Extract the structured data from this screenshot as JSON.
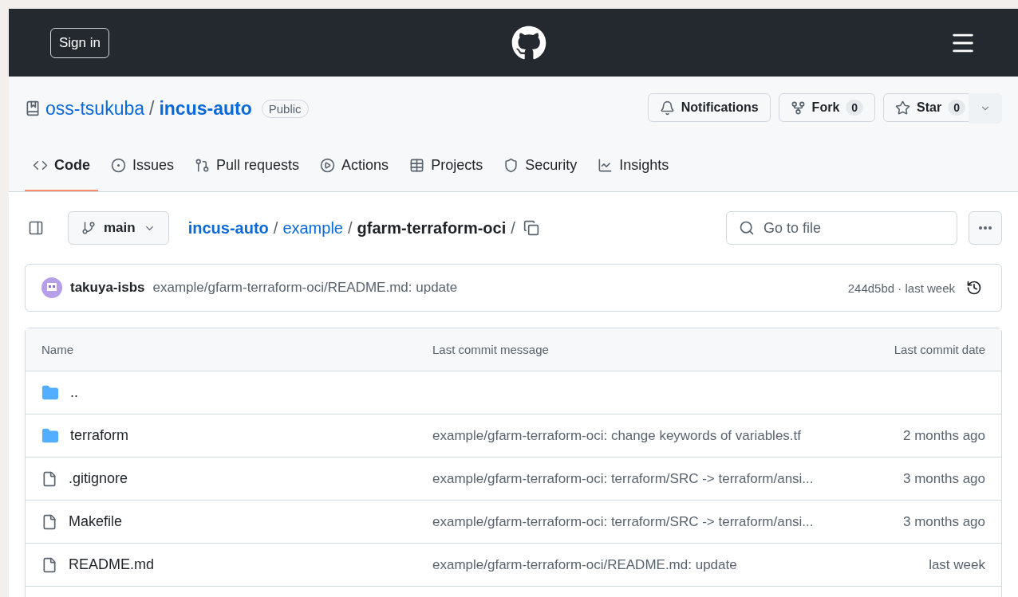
{
  "header": {
    "sign_in": "Sign in"
  },
  "repo": {
    "owner": "oss-tsukuba",
    "separator": "/",
    "name": "incus-auto",
    "visibility": "Public",
    "actions": [
      {
        "kind": "notifications",
        "label": "Notifications"
      },
      {
        "kind": "fork",
        "label": "Fork",
        "count": "0"
      },
      {
        "kind": "star",
        "label": "Star",
        "count": "0"
      }
    ]
  },
  "tabs": [
    {
      "kind": "code",
      "label": "Code",
      "selected": true
    },
    {
      "kind": "issues",
      "label": "Issues",
      "selected": false
    },
    {
      "kind": "pulls",
      "label": "Pull requests",
      "selected": false
    },
    {
      "kind": "actions",
      "label": "Actions",
      "selected": false
    },
    {
      "kind": "projects",
      "label": "Projects",
      "selected": false
    },
    {
      "kind": "security",
      "label": "Security",
      "selected": false
    },
    {
      "kind": "insights",
      "label": "Insights",
      "selected": false
    }
  ],
  "branch": "main",
  "breadcrumb": [
    {
      "label": "incus-auto",
      "kind": "root"
    },
    {
      "label": "/",
      "kind": "sep"
    },
    {
      "label": "example",
      "kind": "link"
    },
    {
      "label": "/",
      "kind": "sep"
    },
    {
      "label": "gfarm-terraform-oci",
      "kind": "current"
    },
    {
      "label": "/",
      "kind": "sep"
    }
  ],
  "search": {
    "placeholder": "Go to file"
  },
  "commit": {
    "author": "takuya-isbs",
    "message": "example/gfarm-terraform-oci/README.md: update",
    "sha": "244d5bd · last week"
  },
  "table": {
    "columns": [
      "Name",
      "Last commit message",
      "Last commit date"
    ],
    "rows": [
      {
        "kind": "folder",
        "name": "..",
        "message": "",
        "date": ""
      },
      {
        "kind": "folder",
        "name": "terraform",
        "message": "example/gfarm-terraform-oci: change keywords of variables.tf",
        "date": "2 months ago"
      },
      {
        "kind": "file",
        "name": ".gitignore",
        "message": "example/gfarm-terraform-oci: terraform/SRC -> terraform/ansi...",
        "date": "3 months ago"
      },
      {
        "kind": "file",
        "name": "Makefile",
        "message": "example/gfarm-terraform-oci: terraform/SRC -> terraform/ansi...",
        "date": "3 months ago"
      },
      {
        "kind": "file",
        "name": "README.md",
        "message": "example/gfarm-terraform-oci/README.md: update",
        "date": "last week"
      }
    ]
  }
}
